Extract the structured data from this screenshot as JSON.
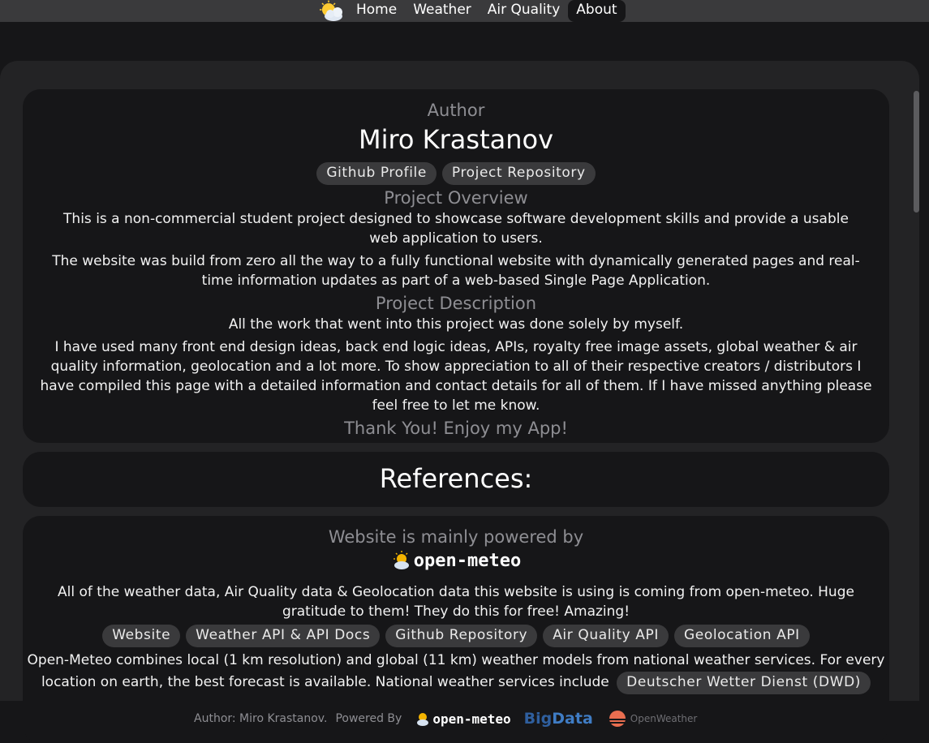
{
  "nav": {
    "links": [
      "Home",
      "Weather",
      "Air Quality",
      "About"
    ],
    "active": "About"
  },
  "author_card": {
    "author_heading": "Author",
    "author_name": "Miro Krastanov",
    "links": [
      "Github Profile",
      "Project Repository"
    ],
    "overview_heading": "Project Overview",
    "overview_p1": "This is a non-commercial student project designed to showcase software development skills and provide a usable web application to users.",
    "overview_p2": "The website was build from zero all the way to a fully functional website with dynamically generated pages and real-time information updates as part of a web-based Single Page Application.",
    "description_heading": "Project Description",
    "description_p1": "All the work that went into this project was done solely by myself.",
    "description_p2": "I have used many front end design ideas, back end logic ideas, APIs, royalty free image assets, global weather & air quality information, geolocation and a lot more. To show appreciation to all of their respective creators / distributors I have compiled this page with a detailed information and contact details for all of them. If I have missed anything please feel free to let me know.",
    "thanks": "Thank You! Enjoy my App!"
  },
  "references_title": "References:",
  "powered_card": {
    "heading": "Website is mainly powered by",
    "logo_text": "open-meteo",
    "p1": "All of the weather data, Air Quality data & Geolocation data this website is using is coming from open-meteo. Huge gratitude to them! They do this for free! Amazing!",
    "links": [
      "Website",
      "Weather API & API Docs",
      "Github Repository",
      "Air Quality API",
      "Geolocation API"
    ],
    "p2_line1": "Open-Meteo combines local (1 km resolution) and global (11 km) weather models from national weather services. For every",
    "p2_line2": "location on earth, the best forecast is available. National weather services include",
    "p2_pill": "Deutscher Wetter Dienst (DWD)"
  },
  "footer": {
    "author_text": "Author: Miro Krastanov.",
    "powered_text": "Powered By",
    "logo_openmeteo": "open-meteo",
    "logo_bigdata_a": "Big",
    "logo_bigdata_b": "Data",
    "logo_openweather": "OpenWeather"
  },
  "colors": {
    "page_bg": "#161618",
    "nav_bg": "#3a3a3c",
    "container_bg": "#232325",
    "pill_bg": "#3a3a3c",
    "muted_text": "#8e8e93"
  }
}
